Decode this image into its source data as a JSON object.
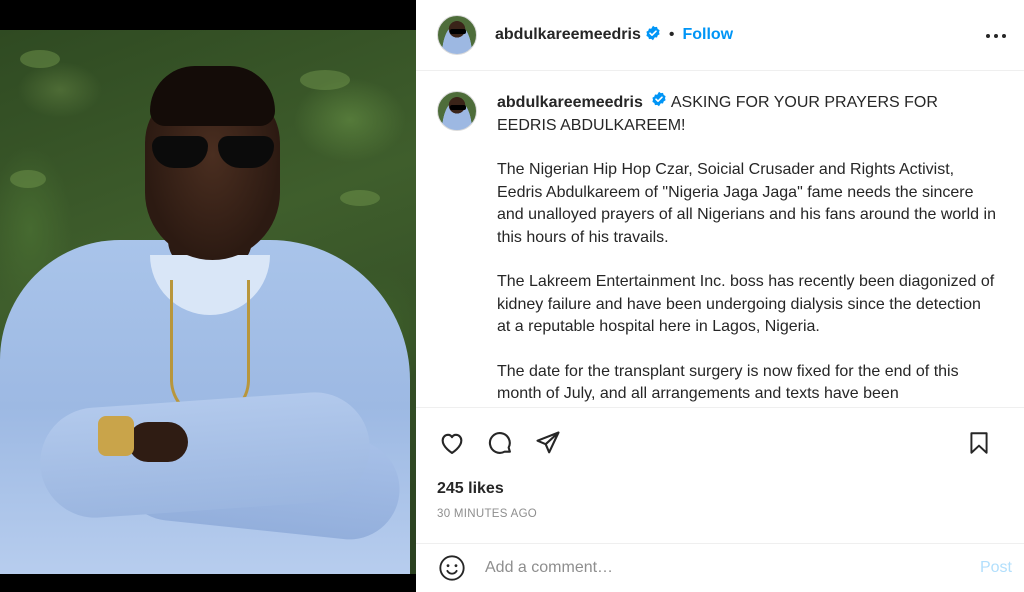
{
  "post": {
    "username": "abdulkareemeedris",
    "separator": "•",
    "follow_label": "Follow",
    "caption": {
      "username": "abdulkareemeedris",
      "headline": "ASKING FOR YOUR PRAYERS FOR EEDRIS ABDULKAREEM!",
      "paragraphs": [
        "The Nigerian Hip Hop Czar, Soicial Crusader and Rights Activist, Eedris Abdulkareem of \"Nigeria Jaga Jaga\" fame needs the sincere and unalloyed prayers of all Nigerians and his fans around the world in this hours of his travails.",
        "The Lakreem Entertainment Inc. boss has recently been diagonized of kidney failure and have been undergoing dialysis since the detection at a reputable hospital here in Lagos, Nigeria.",
        "The date for the transplant surgery is now fixed for the end of this month of July, and all arrangements and texts have been"
      ]
    },
    "likes": "245 likes",
    "timestamp": "30 MINUTES AGO"
  },
  "comment": {
    "placeholder": "Add a comment…",
    "post_label": "Post"
  },
  "icons": {
    "verified": "verified-badge-icon",
    "more": "more-options-icon",
    "like": "heart-icon",
    "comment": "comment-icon",
    "share": "paper-plane-icon",
    "save": "bookmark-icon",
    "emoji": "emoji-icon"
  },
  "colors": {
    "accent": "#0095f6",
    "post_disabled": "#b2dffc",
    "muted": "#8e8e8e"
  }
}
